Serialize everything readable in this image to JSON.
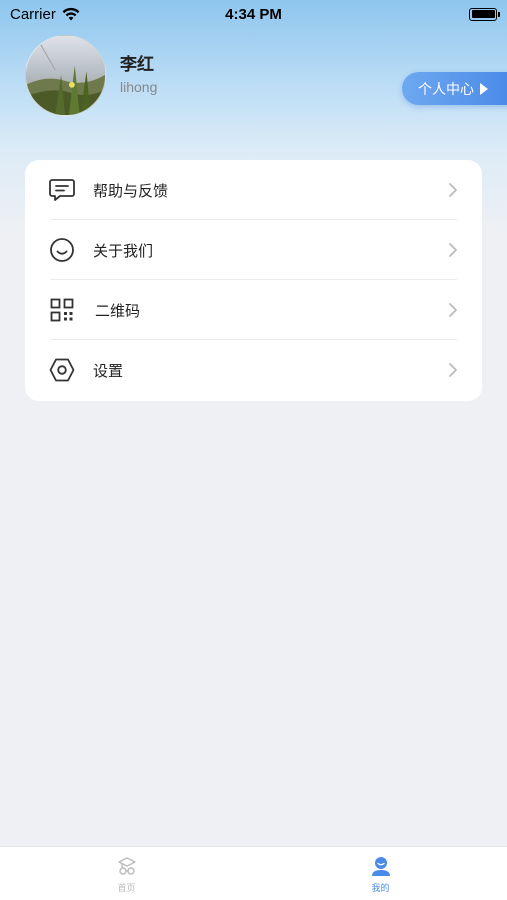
{
  "status_bar": {
    "carrier": "Carrier",
    "time": "4:34 PM"
  },
  "profile": {
    "name": "李红",
    "username": "lihong",
    "personal_center_label": "个人中心"
  },
  "menu": {
    "items": [
      {
        "label": "帮助与反馈",
        "icon": "feedback-icon"
      },
      {
        "label": "关于我们",
        "icon": "smile-icon"
      },
      {
        "label": "二维码",
        "icon": "qr-code-icon"
      },
      {
        "label": "设置",
        "icon": "settings-icon"
      }
    ]
  },
  "tab_bar": {
    "tabs": [
      {
        "label": "首页",
        "icon": "home-icon",
        "active": false
      },
      {
        "label": "我的",
        "icon": "user-icon",
        "active": true
      }
    ]
  },
  "colors": {
    "accent": "#4a8ae8",
    "inactive_tab": "#bbbbbb",
    "background": "#eef0f4"
  }
}
